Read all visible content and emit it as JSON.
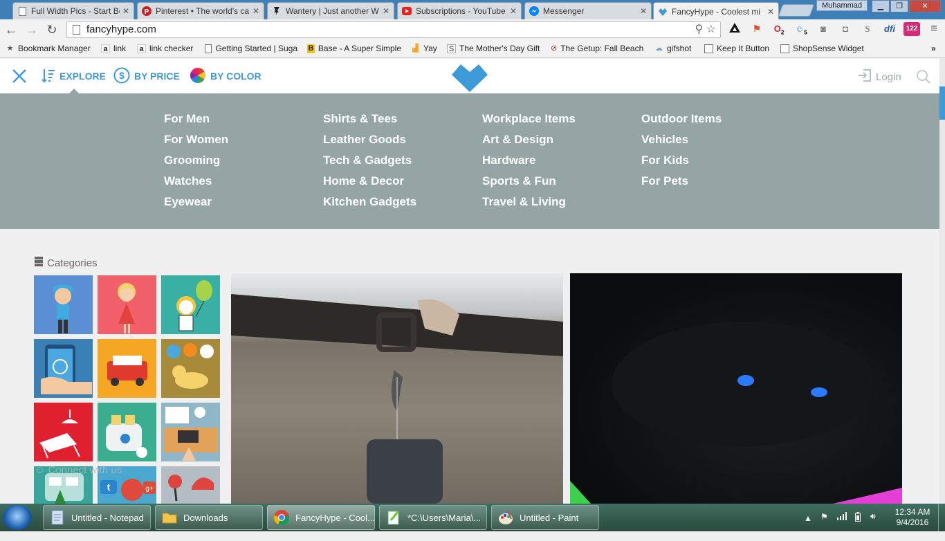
{
  "browser": {
    "tabs": [
      {
        "title": "Full Width Pics - Start Bo",
        "icon": "page-icon"
      },
      {
        "title": "Pinterest • The world's ca",
        "icon": "pinterest-icon"
      },
      {
        "title": "Wantery | Just another W",
        "icon": "pin-icon"
      },
      {
        "title": "Subscriptions - YouTube",
        "icon": "youtube-icon"
      },
      {
        "title": "Messenger",
        "icon": "messenger-icon"
      },
      {
        "title": "FancyHype - Coolest mi",
        "icon": "fancyhype-heart-icon",
        "active": true
      }
    ],
    "profile_name": "Muhammad",
    "url": "fancyhype.com",
    "bookmarks": [
      {
        "label": "Bookmark Manager",
        "icon": "star-icon"
      },
      {
        "label": "link",
        "icon": "amazon-icon"
      },
      {
        "label": "link checker",
        "icon": "amazon-icon"
      },
      {
        "label": "Getting Started | Suga",
        "icon": "page-icon"
      },
      {
        "label": "Base - A Super Simple",
        "icon": "base-icon"
      },
      {
        "label": "Yay",
        "icon": "chart-icon"
      },
      {
        "label": "The Mother's Day Gift",
        "icon": "s-icon"
      },
      {
        "label": "The Getup: Fall Beach",
        "icon": "link-icon"
      },
      {
        "label": "gifshot",
        "icon": "cloud-icon"
      },
      {
        "label": "Keep It Button",
        "icon": "page-icon"
      },
      {
        "label": "ShopSense Widget",
        "icon": "page-icon"
      }
    ],
    "extension_badges": [
      "2",
      "5",
      "122"
    ]
  },
  "site": {
    "nav": {
      "explore": "EXPLORE",
      "by_price": "BY PRICE",
      "by_color": "BY COLOR",
      "login": "Login"
    },
    "menu_columns": [
      [
        "For Men",
        "For Women",
        "Grooming",
        "Watches",
        "Eyewear"
      ],
      [
        "Shirts & Tees",
        "Leather Goods",
        "Tech & Gadgets",
        "Home & Decor",
        "Kitchen Gadgets"
      ],
      [
        "Workplace Items",
        "Art & Design",
        "Hardware",
        "Sports & Fun",
        "Travel & Living"
      ],
      [
        "Outdoor Items",
        "Vehicles",
        "For Kids",
        "For Pets"
      ]
    ],
    "categories_title": "Categories",
    "connect_title": "Connect with us",
    "accent_color": "#3d9ad8",
    "menu_bg": "#95a5a6"
  },
  "taskbar": {
    "items": [
      {
        "label": "Untitled - Notepad",
        "icon": "notepad-icon"
      },
      {
        "label": "Downloads",
        "icon": "folder-icon"
      },
      {
        "label": "FancyHype - Cool...",
        "icon": "chrome-icon",
        "active": true
      },
      {
        "label": "*C:\\Users\\Maria\\...",
        "icon": "notepadpp-icon"
      },
      {
        "label": "Untitled - Paint",
        "icon": "paint-icon"
      }
    ],
    "time": "12:34 AM",
    "date": "9/4/2016"
  }
}
